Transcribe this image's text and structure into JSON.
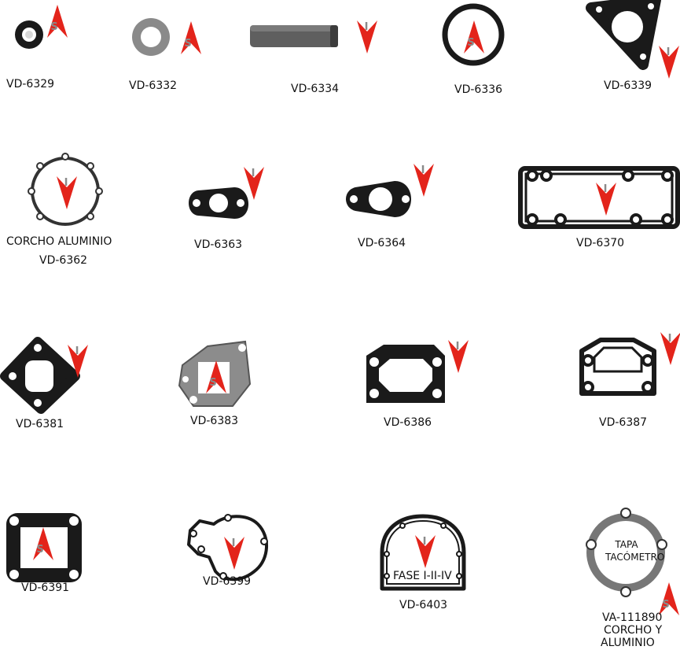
{
  "colors": {
    "arrow": "#e3241b",
    "marker_text": "#8a8a8a",
    "gasket": "#1a1a1a",
    "paper": "#8c8c8c"
  },
  "markers": {
    "s": "S",
    "i": "I"
  },
  "items": [
    {
      "code": "VD-6329",
      "marker": "s",
      "icon": "small-seal-icon"
    },
    {
      "code": "VD-6332",
      "marker": "s",
      "icon": "washer-icon"
    },
    {
      "code": "VD-6334",
      "marker": "i",
      "icon": "pin-icon"
    },
    {
      "code": "VD-6336",
      "marker": "s",
      "icon": "o-ring-icon"
    },
    {
      "code": "VD-6339",
      "marker": "i",
      "icon": "triangular-gasket-icon"
    },
    {
      "code": "VD-6362",
      "note": "CORCHO ALUMINIO",
      "marker": "i",
      "icon": "round-cork-gasket-icon"
    },
    {
      "code": "VD-6363",
      "marker": "i",
      "icon": "oval-flange-gasket-icon"
    },
    {
      "code": "VD-6364",
      "marker": "i",
      "icon": "oval-flange-gasket-icon"
    },
    {
      "code": "VD-6370",
      "marker": "i",
      "icon": "rectangular-gasket-icon"
    },
    {
      "code": "VD-6381",
      "marker": "i",
      "icon": "diamond-gasket-icon"
    },
    {
      "code": "VD-6383",
      "marker": "s",
      "icon": "paper-gasket-icon"
    },
    {
      "code": "VD-6386",
      "marker": "i",
      "icon": "housing-gasket-icon"
    },
    {
      "code": "VD-6387",
      "marker": "i",
      "icon": "housing-gasket-icon"
    },
    {
      "code": "VD-6391",
      "marker": "s",
      "icon": "square-gasket-icon"
    },
    {
      "code": "VD-6399",
      "marker": "i",
      "icon": "water-pump-gasket-icon"
    },
    {
      "code": "VD-6403",
      "note": "FASE I-II-IV",
      "marker": "i",
      "icon": "arch-gasket-icon"
    },
    {
      "code": "VA-111890",
      "note": "TAPA TACÓMETRO",
      "sub1": "CORCHO Y",
      "sub2": "ALUMINIO",
      "marker": "s",
      "icon": "tachometer-cover-gasket-icon"
    }
  ]
}
